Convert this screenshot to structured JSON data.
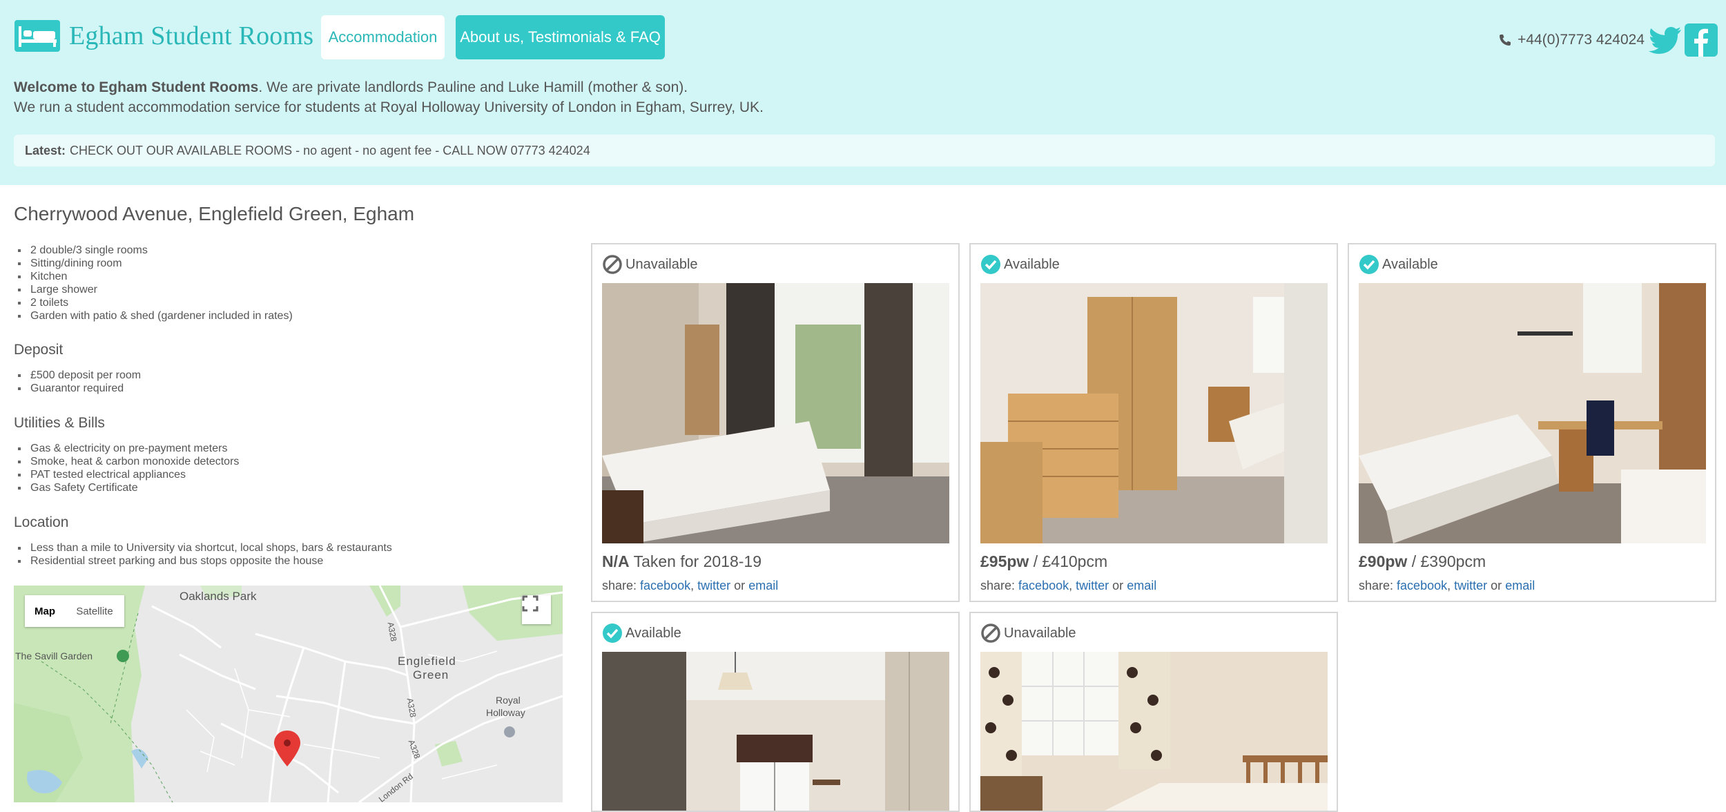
{
  "header": {
    "brand_name": "Egham Student Rooms",
    "nav": [
      {
        "label": "Accommodation"
      },
      {
        "label": "About us, Testimonials & FAQ"
      }
    ],
    "phone": "+44(0)7773 424024",
    "welcome_bold": "Welcome to Egham Student Rooms",
    "welcome_line1_rest": ". We are private landlords Pauline and Luke Hamill (mother & son).",
    "welcome_line2": "We run a student accommodation service for students at Royal Holloway University of London in Egham, Surrey, UK.",
    "latest_label": "Latest:",
    "latest_text": "CHECK OUT OUR AVAILABLE ROOMS - no agent - no agent fee - CALL NOW 07773 424024"
  },
  "property": {
    "title": "Cherrywood Avenue, Englefield Green, Egham",
    "features": [
      "2 double/3 single rooms",
      "Sitting/dining room",
      "Kitchen",
      "Large shower",
      "2 toilets",
      "Garden with patio & shed (gardener included in rates)"
    ],
    "deposit_heading": "Deposit",
    "deposit": [
      "£500 deposit per room",
      "Guarantor required"
    ],
    "utilities_heading": "Utilities & Bills",
    "utilities": [
      "Gas & electricity on pre-payment meters",
      "Smoke, heat & carbon monoxide detectors",
      "PAT tested electrical appliances",
      "Gas Safety Certificate"
    ],
    "location_heading": "Location",
    "location": [
      "Less than a mile to University via shortcut, local shops, bars & restaurants",
      "Residential street parking and bus stops opposite the house"
    ]
  },
  "map": {
    "map_label": "Map",
    "satellite_label": "Satellite",
    "places": {
      "oaklands": "Oaklands Park",
      "savill": "The Savill Garden",
      "englefield_1": "Englefield",
      "englefield_2": "Green",
      "royal_1": "Royal",
      "royal_2": "Holloway",
      "a328_1": "A328",
      "a328_2": "A328",
      "a328_3": "A328",
      "london_rd": "London Rd"
    }
  },
  "rooms": [
    {
      "status": "Unavailable",
      "price_bold": "N/A",
      "price_rest": " Taken for 2018-19"
    },
    {
      "status": "Available",
      "price_bold": "£95pw",
      "price_rest": " / £410pcm"
    },
    {
      "status": "Available",
      "price_bold": "£90pw",
      "price_rest": " / £390pcm"
    },
    {
      "status": "Available"
    },
    {
      "status": "Unavailable"
    }
  ],
  "share": {
    "label": "share:",
    "facebook": "facebook",
    "twitter": "twitter",
    "or": "or",
    "email": "email"
  },
  "colors": {
    "accent": "#33c9c9",
    "header_bg": "#d2f5f5",
    "link": "#2a6fb0"
  }
}
